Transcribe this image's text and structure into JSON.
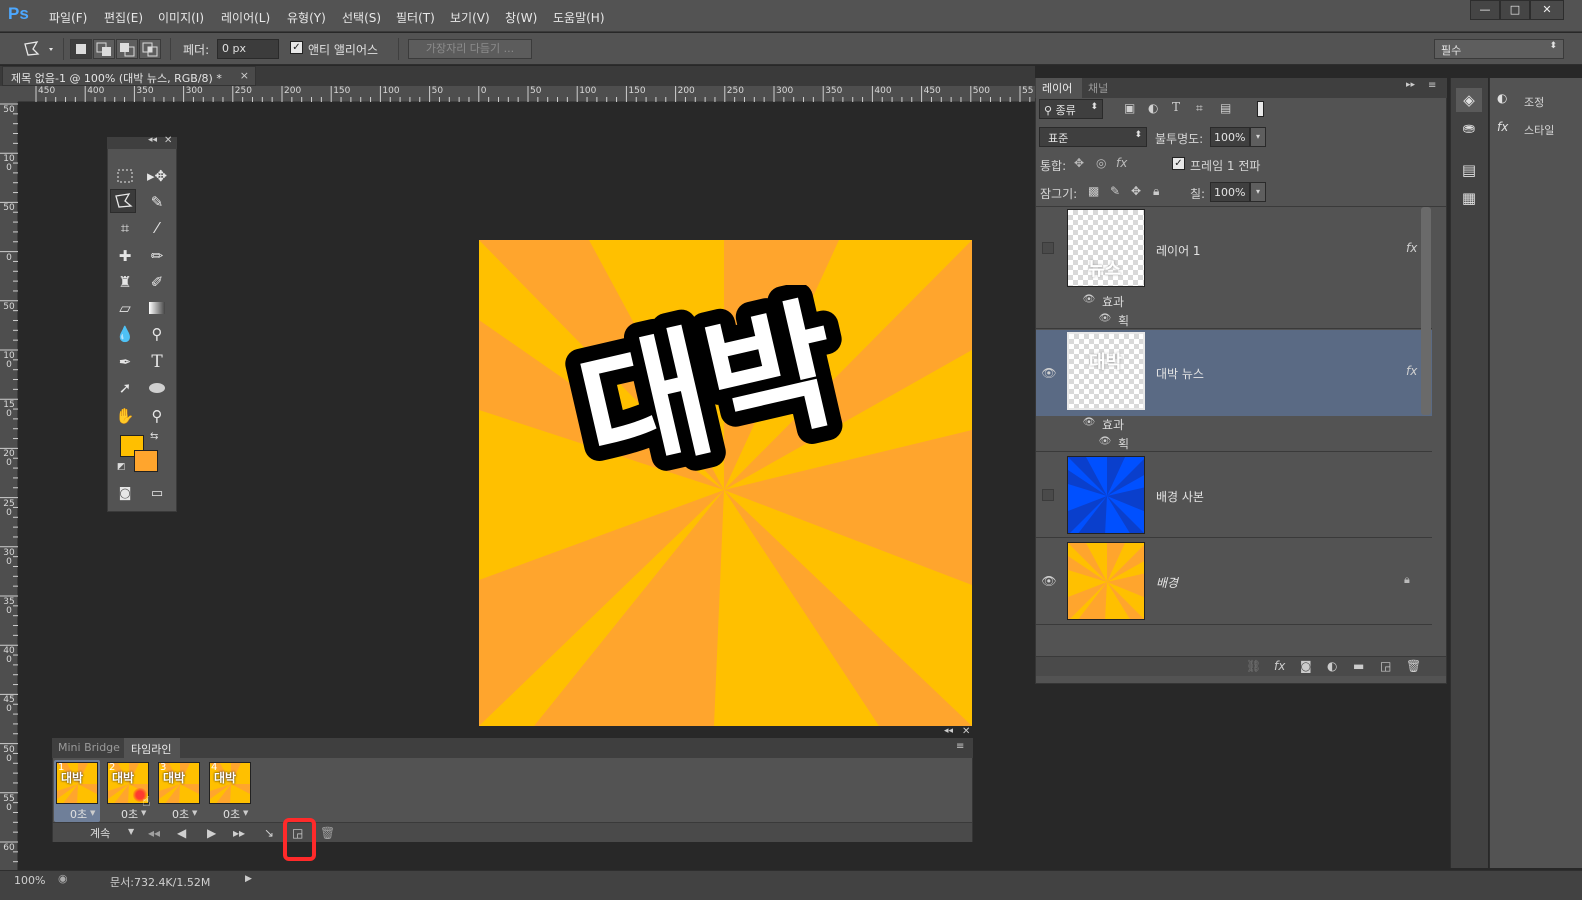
{
  "app": {
    "logo": "Ps"
  },
  "menu": [
    "파일(F)",
    "편집(E)",
    "이미지(I)",
    "레이어(L)",
    "유형(Y)",
    "선택(S)",
    "필터(T)",
    "보기(V)",
    "창(W)",
    "도움말(H)"
  ],
  "window_controls": {
    "minimize": "—",
    "restore": "□",
    "close": "✕"
  },
  "options": {
    "feather_label": "페더:",
    "feather_value": "0 px",
    "antialias_label": "앤티 앨리어스",
    "refine_edge": "가장자리 다듬기 ...",
    "workspace": "필수"
  },
  "document": {
    "tab_title": "제목 없음-1 @ 100% (대박 뉴스, RGB/8) *",
    "close": "×"
  },
  "ruler_h_labels": [
    "450",
    "400",
    "350",
    "300",
    "250",
    "200",
    "150",
    "100",
    "50",
    "0",
    "50",
    "100",
    "150",
    "200",
    "250",
    "300",
    "350",
    "400",
    "450",
    "500",
    "55"
  ],
  "ruler_v_labels": [
    "50",
    "100",
    "50",
    "0",
    "50",
    "100",
    "150",
    "200",
    "250",
    "300",
    "350",
    "400",
    "450",
    "500",
    "550",
    "60"
  ],
  "canvas_text": "대박",
  "colors": {
    "foreground": "#ffbf00",
    "background": "#ffa52d",
    "selected_row": "#5a6a84",
    "frame_marker": "#ff2a2a"
  },
  "layers_panel": {
    "tabs": [
      "레이어",
      "채널"
    ],
    "filter_kind": "종류",
    "blend_mode": "표준",
    "opacity_label": "불투명도:",
    "opacity_value": "100%",
    "unify_label": "통합:",
    "propagate_label": "프레임 1 전파",
    "lock_label": "잠그기:",
    "fill_label": "칠:",
    "fill_value": "100%",
    "layers": [
      {
        "name": "레이어 1",
        "has_fx": true,
        "effects_label": "효과",
        "effect": "획",
        "visible": false,
        "thumb_text": "뉴스"
      },
      {
        "name": "대박 뉴스",
        "has_fx": true,
        "effects_label": "효과",
        "effect": "획",
        "visible": true,
        "selected": true,
        "thumb_text": "대박"
      },
      {
        "name": "배경 사본",
        "has_fx": false,
        "visible": false
      },
      {
        "name": "배경",
        "has_fx": false,
        "visible": true,
        "locked": true
      }
    ]
  },
  "right_dock": {
    "adjust": "조정",
    "style": "스타일"
  },
  "timeline": {
    "tabs": [
      "Mini Bridge",
      "타임라인"
    ],
    "frames": [
      {
        "num": "1",
        "delay": "0초",
        "thumb_text": "대박"
      },
      {
        "num": "2",
        "delay": "0초",
        "thumb_text": "대박"
      },
      {
        "num": "3",
        "delay": "0초",
        "thumb_text": "대박"
      },
      {
        "num": "4",
        "delay": "0초",
        "thumb_text": "대박"
      }
    ],
    "loop": "계속"
  },
  "status": {
    "zoom": "100%",
    "doc_info": "문서:732.4K/1.52M"
  }
}
